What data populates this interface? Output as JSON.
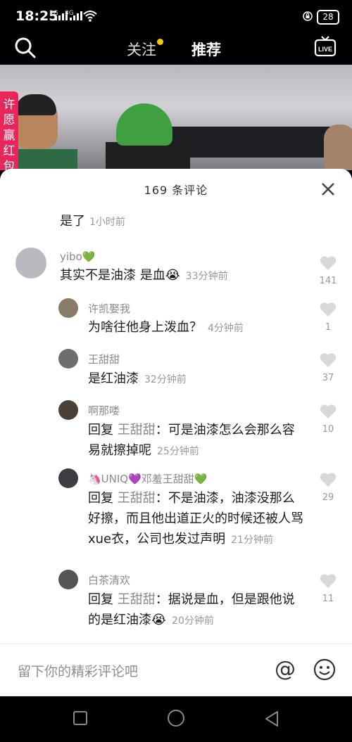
{
  "status": {
    "time": "18:25",
    "net1": "2G",
    "net2": "3G",
    "battery": "28"
  },
  "topnav": {
    "follow": "关注",
    "recommend": "推荐",
    "live": "LIVE"
  },
  "hongbao": "许愿赢红包",
  "comments_sheet": {
    "title": "169 条评论",
    "partial_top": {
      "text": "是了",
      "time": "1小时前"
    },
    "comments": [
      {
        "user": "yibo",
        "user_suffix": "💚",
        "text": "其实不是油漆 是血",
        "emoji": "😭",
        "time": "33分钟前",
        "likes": "141",
        "avatar_color": "#b9b9c0",
        "level": 0
      },
      {
        "user": "许凯娶我",
        "text": "为啥往他身上泼血？",
        "time": "4分钟前",
        "likes": "1",
        "avatar_color": "#8a7a68",
        "level": 1
      },
      {
        "user": "王甜甜",
        "text": "是红油漆",
        "time": "32分钟前",
        "likes": "37",
        "avatar_color": "#6e6e6e",
        "level": 1
      },
      {
        "user": "啊那喽",
        "reply_prefix": "回复",
        "reply_to": "王甜甜",
        "text": "：可是油漆怎么会那么容易就擦掉呢",
        "time": "25分钟前",
        "likes": "10",
        "avatar_color": "#4a4038",
        "level": 1
      },
      {
        "user_prefix": "🦄UNIQ",
        "user_heart": "💜",
        "user": "邓羞王甜甜",
        "user_suffix": "💚",
        "text": "不是油漆，油漆没那么好擦，而且他出道正火的时候还被人骂xue衣，公司也发过声明",
        "reply_prefix": "回复",
        "reply_to": "王甜甜",
        "time": "21分钟前",
        "likes": "29",
        "avatar_color": "#3c3c44",
        "level": 1
      },
      {
        "user": "白茶清欢",
        "reply_prefix": "回复",
        "reply_to": "王甜甜",
        "text": "：据说是血，但是跟他说的是红油漆",
        "emoji": "😭",
        "time": "20分钟前",
        "likes": "11",
        "avatar_color": "#555",
        "level": 1
      }
    ]
  },
  "input": {
    "placeholder": "留下你的精彩评论吧",
    "at": "@"
  }
}
